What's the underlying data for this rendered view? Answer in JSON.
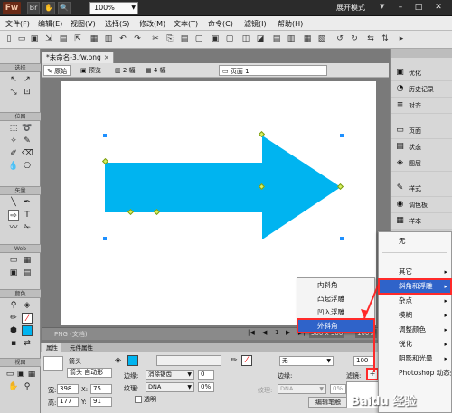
{
  "app": {
    "logo": "Fw",
    "zoom": "100%",
    "workspace_mode": "展开模式"
  },
  "menu": [
    "文件(F)",
    "编辑(E)",
    "视图(V)",
    "选择(S)",
    "修改(M)",
    "文本(T)",
    "命令(C)",
    "滤镜(I)",
    "帮助(H)"
  ],
  "document": {
    "tab_title": "*未命名-3.fw.png",
    "tab_close": "×"
  },
  "view_tabs": {
    "original": "原始",
    "preview": "预览",
    "two_up": "2 幅",
    "four_up": "4 幅",
    "page": "页面 1"
  },
  "tools": {
    "select": "选择",
    "bitmap": "位图",
    "vector": "矢量",
    "web": "Web",
    "colors": "颜色",
    "view": "视图"
  },
  "status": {
    "file_type": "PNG (文档)",
    "size": "500 x 500",
    "zoom": "100%",
    "page_number": "1"
  },
  "right_panel": {
    "items": [
      "优化",
      "历史记录",
      "对齐",
      "页面",
      "状态",
      "图层",
      "样式",
      "调色板",
      "样本"
    ]
  },
  "properties": {
    "tab_properties": "属性",
    "tab_symbol": "元件属性",
    "shape_type": "箭头",
    "shape_name": "箭头 自动形",
    "edge_label": "边缘:",
    "edge_value": "消除锯齿",
    "texture_label": "纹理:",
    "texture_value": "DNA",
    "texture_pct": "0%",
    "transparent_label": "透明",
    "width_label": "宽:",
    "width_value": "398",
    "height_label": "高:",
    "height_value": "177",
    "x_label": "X:",
    "x_value": "75",
    "y_label": "Y:",
    "y_value": "91",
    "stroke_edge_label": "边缘:",
    "stroke_texture_label": "纹理:",
    "stroke_texture_value": "DNA",
    "stroke_texture_pct": "0%",
    "stroke_fill": "无",
    "opacity": "100",
    "filters_label": "滤镜:",
    "edit_stroke": "编辑笔触"
  },
  "filter_menu": {
    "items": [
      "无",
      "其它",
      "斜角和浮雕",
      "杂点",
      "模糊",
      "调整颜色",
      "锐化",
      "阴影和光晕",
      "Photoshop 动态效果..."
    ],
    "highlighted": "斜角和浮雕"
  },
  "bevel_submenu": {
    "items": [
      "内斜角",
      "凸起浮雕",
      "凹入浮雕",
      "外斜角"
    ],
    "highlighted": "外斜角"
  },
  "watermark": "Baidu 经验",
  "colors": {
    "arrow_fill": "#00b4f0",
    "highlight": "#2f63c9",
    "annotation": "#ff2a2a"
  }
}
